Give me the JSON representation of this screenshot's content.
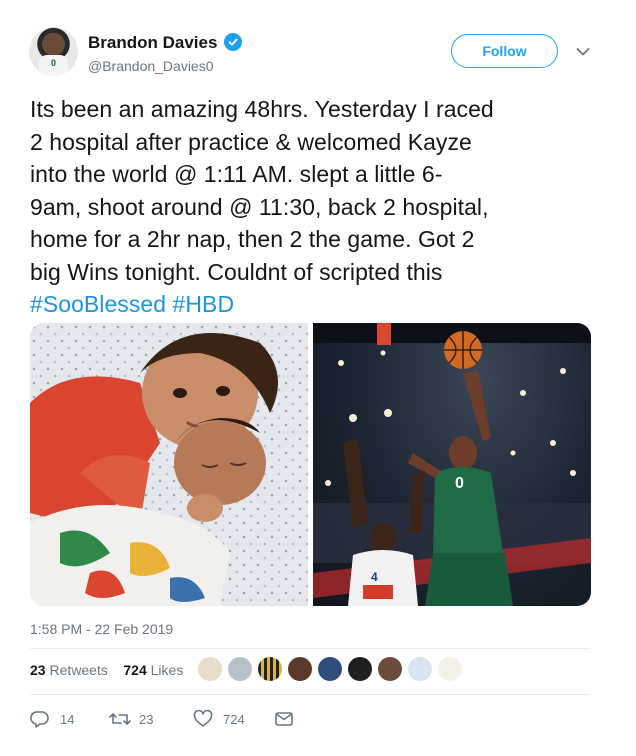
{
  "author": {
    "name": "Brandon Davies",
    "handle": "@Brandon_Davies0",
    "jersey_number": "0",
    "verified": true
  },
  "follow_button": {
    "label": "Follow"
  },
  "tweet": {
    "lines": [
      "Its been an amazing 48hrs. Yesterday I raced",
      "2 hospital after practice & welcomed Kayze",
      "into the world @ 1:11 AM. slept a little 6-",
      "9am, shoot around @ 11:30, back 2 hospital,",
      "home for a 2hr nap, then 2 the game. Got 2",
      "big Wins tonight. Couldnt of scripted this"
    ],
    "hashtags": [
      "#SooBlessed",
      "#HBD"
    ]
  },
  "timestamp": "1:58 PM - 22 Feb 2019",
  "stats": {
    "retweets_count": "23",
    "retweets_label": "Retweets",
    "likes_count": "724",
    "likes_label": "Likes"
  },
  "actions": {
    "replies": "14",
    "retweets": "23",
    "likes": "724"
  },
  "colors": {
    "accent": "#1da1f2",
    "hashtag": "#1b95e0",
    "muted": "#657786",
    "text": "#14171a",
    "divider": "#e6ecf0"
  },
  "icons": {
    "verified": "verified-badge-icon",
    "chevron": "chevron-down-icon",
    "reply": "reply-icon",
    "retweet": "retweet-icon",
    "like": "heart-icon",
    "dm": "envelope-icon"
  }
}
